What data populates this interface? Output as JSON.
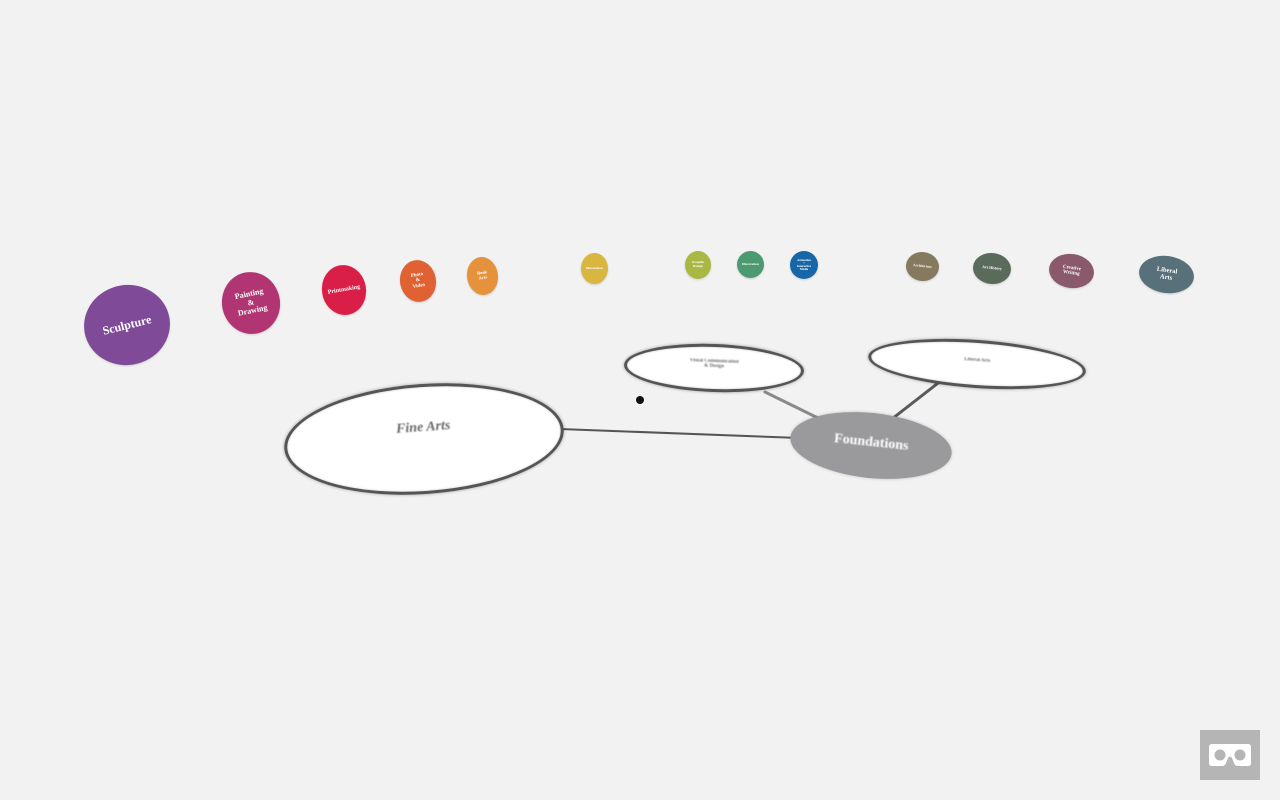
{
  "ring": [
    {
      "label": "Sculpture",
      "color": "#7f4a98"
    },
    {
      "label": "Painting\n&\nDrawing",
      "color": "#b03572"
    },
    {
      "label": "Printmaking",
      "color": "#d91e47"
    },
    {
      "label": "Photo\n&\nVideo",
      "color": "#e06233"
    },
    {
      "label": "Book\nArts",
      "color": "#e6913c"
    },
    {
      "label": "Illustration",
      "color": "#d8b640"
    },
    {
      "label": "Graphic\nDesign",
      "color": "#a9b843"
    },
    {
      "label": "Illustration",
      "color": "#4c9a6f"
    },
    {
      "label": "Animation\n+\nInteractive\nMedia",
      "color": "#1767a8"
    },
    {
      "label": "Architecture",
      "color": "#857a5e"
    },
    {
      "label": "Art History",
      "color": "#5a6b5b"
    },
    {
      "label": "Creative\nWriting",
      "color": "#8a5a6c"
    },
    {
      "label": "Liberal\nArts",
      "color": "#58707a"
    }
  ],
  "hubs": {
    "fine_arts": {
      "label": "Fine Arts"
    },
    "design": {
      "label": "Visual Communication\n& Design"
    },
    "humanities": {
      "label": "Liberal Arts"
    },
    "foundations": {
      "label": "Foundations"
    }
  },
  "vr_button": {
    "icon": "vr-goggles-icon"
  }
}
